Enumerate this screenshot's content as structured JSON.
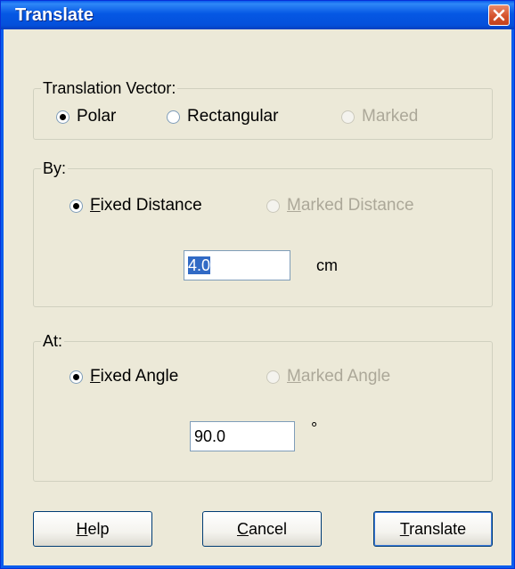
{
  "window": {
    "title": "Translate"
  },
  "translation_vector": {
    "legend": "Translation Vector:",
    "options": [
      {
        "label": "Polar",
        "selected": true,
        "enabled": true
      },
      {
        "label": "Rectangular",
        "selected": false,
        "enabled": true
      },
      {
        "label": "Marked",
        "selected": false,
        "enabled": false
      }
    ]
  },
  "by": {
    "legend": "By:",
    "fixed_label_ul": "F",
    "fixed_label_rest": "ixed Distance",
    "marked_label_ul": "M",
    "marked_label_rest": "arked Distance",
    "distance_value": "4.0",
    "unit": "cm"
  },
  "at": {
    "legend": "At:",
    "fixed_label_ul": "F",
    "fixed_label_rest": "ixed Angle",
    "marked_label_ul": "M",
    "marked_label_rest": "arked Angle",
    "angle_value": "90.0",
    "unit": "°"
  },
  "buttons": {
    "help_ul": "H",
    "help_rest": "elp",
    "cancel_ul": "C",
    "cancel_rest": "ancel",
    "translate_ul": "T",
    "translate_rest": "ranslate"
  },
  "colors": {
    "title_bar": "#0558e4",
    "dialog_bg": "#ece9d8",
    "selection": "#316ac5",
    "close": "#d5532c"
  },
  "icons": {
    "close": "close-icon"
  }
}
